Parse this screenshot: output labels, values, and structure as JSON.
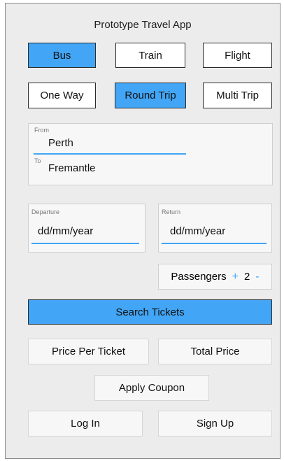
{
  "app": {
    "title": "Prototype Travel App"
  },
  "transport": {
    "bus": "Bus",
    "train": "Train",
    "flight": "Flight",
    "selected": "bus"
  },
  "trip_type": {
    "one_way": "One Way",
    "round_trip": "Round Trip",
    "multi_trip": "Multi Trip",
    "selected": "round_trip"
  },
  "route": {
    "from_label": "From",
    "from_value": "Perth",
    "to_label": "To",
    "to_value": "Fremantle"
  },
  "dates": {
    "departure_label": "Departure",
    "departure_value": "dd/mm/year",
    "return_label": "Return",
    "return_value": "dd/mm/year"
  },
  "passengers": {
    "label": "Passengers",
    "plus": "+",
    "count": "2",
    "minus": "-"
  },
  "search": {
    "label": "Search Tickets"
  },
  "price": {
    "per_ticket": "Price Per Ticket",
    "total": "Total Price"
  },
  "coupon": {
    "label": "Apply Coupon"
  },
  "auth": {
    "login": "Log In",
    "signup": "Sign Up"
  },
  "colors": {
    "accent": "#42a5f5",
    "background": "#ececec",
    "field": "#f7f7f7"
  }
}
